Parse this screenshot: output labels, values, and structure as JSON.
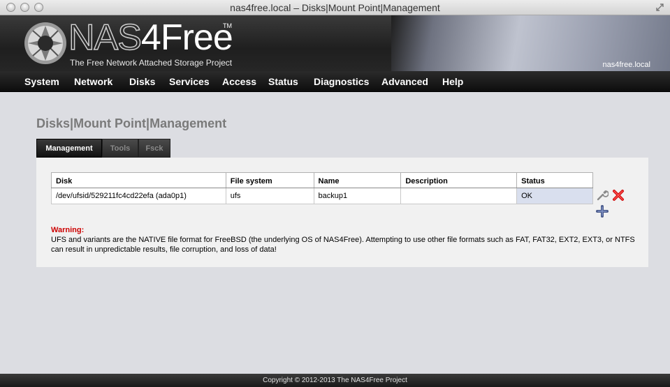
{
  "window": {
    "title": "nas4free.local – Disks|Mount Point|Management"
  },
  "header": {
    "logo_prefix": "NAS",
    "logo_suffix": "4Free",
    "logo_tm": "TM",
    "tagline": "The Free Network Attached Storage Project",
    "hostname": "nas4free.local"
  },
  "nav": {
    "items": [
      "System",
      "Network",
      "Disks",
      "Services",
      "Access",
      "Status",
      "Diagnostics",
      "Advanced",
      "Help"
    ]
  },
  "page": {
    "title": "Disks|Mount Point|Management"
  },
  "tabs": [
    "Management",
    "Tools",
    "Fsck"
  ],
  "table": {
    "columns": [
      "Disk",
      "File system",
      "Name",
      "Description",
      "Status"
    ],
    "rows": [
      [
        "/dev/ufsid/529211fc4cd22efa (ada0p1)",
        "ufs",
        "backup1",
        "",
        "OK"
      ]
    ]
  },
  "icons": {
    "edit": "wrench-icon",
    "delete": "red-x-icon",
    "add": "plus-icon"
  },
  "warning": {
    "title": "Warning:",
    "text": "UFS and variants are the NATIVE file format for FreeBSD (the underlying OS of NAS4Free). Attempting to use other file formats such as FAT, FAT32, EXT2, EXT3, or NTFS can result in unpredictable results, file corruption, and loss of data!"
  },
  "footer": {
    "copyright": "Copyright © 2012-2013 The NAS4Free Project"
  },
  "colors": {
    "warning": "#cc0000",
    "status_cell": "#d9dfee",
    "page_bg": "#dcdde2"
  }
}
